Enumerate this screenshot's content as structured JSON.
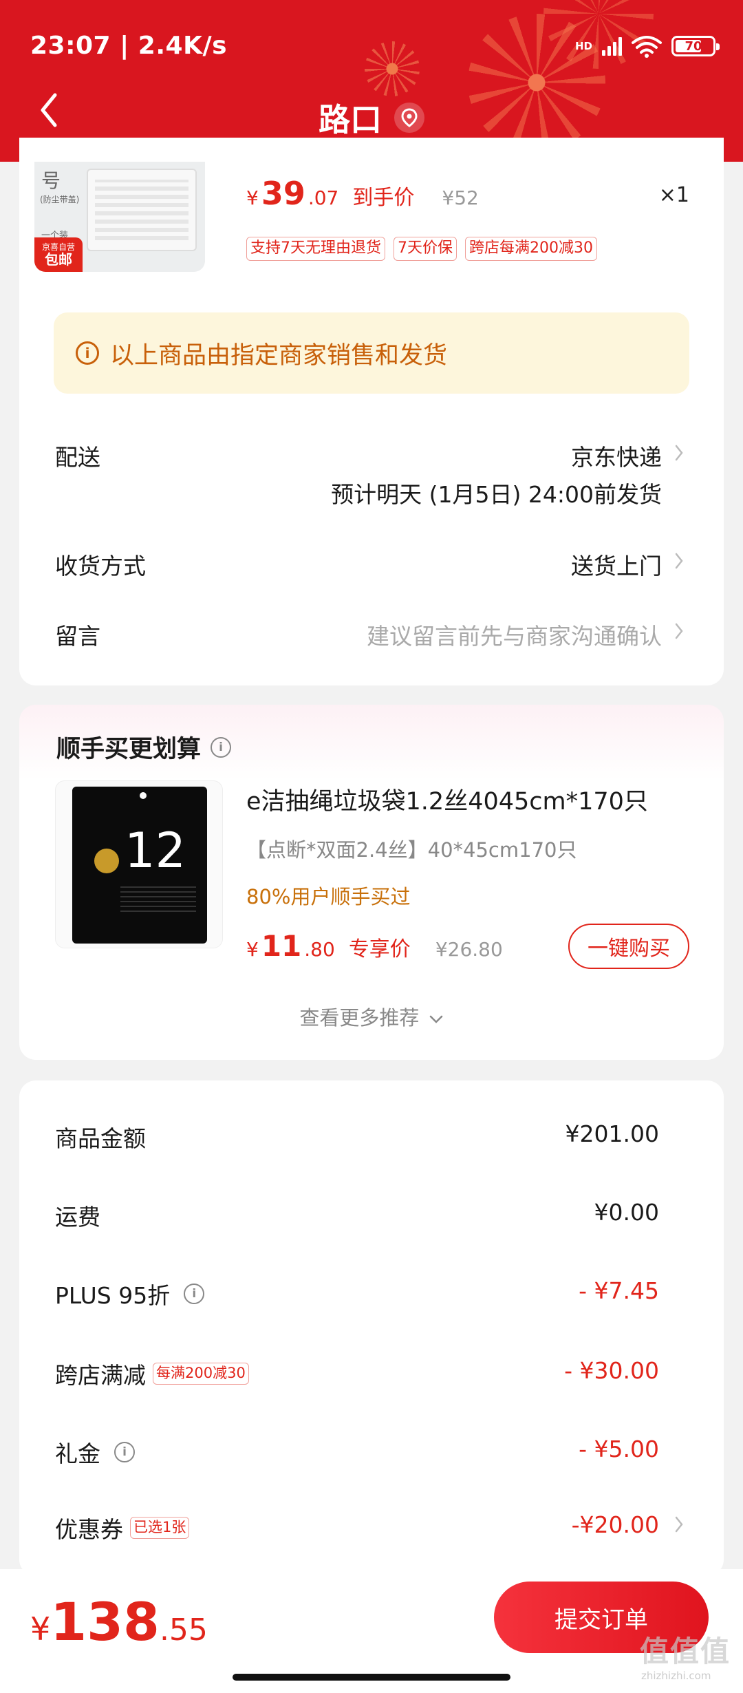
{
  "status_bar": {
    "time": "23:07 | 2.4K/s",
    "network": "HD",
    "battery": "70"
  },
  "header": {
    "title": "路口",
    "icons": {
      "back": "chevron-left-icon",
      "location": "location-pin-icon"
    }
  },
  "product": {
    "thumb_note1": "号",
    "thumb_note2": "(防尘带盖)",
    "thumb_note3": "一个装",
    "badge_line1": "京喜自营",
    "badge_line2": "包邮",
    "currency": "¥",
    "price_int": "39",
    "price_dec": ".07",
    "price_label": "到手价",
    "orig_price": "¥52",
    "qty": "×1",
    "tags": [
      "支持7天无理由退货",
      "7天价保",
      "跨店每满200减30"
    ]
  },
  "notice": {
    "text": "以上商品由指定商家销售和发货"
  },
  "delivery": {
    "label": "配送",
    "carrier": "京东快递",
    "eta": "预计明天 (1月5日) 24:00前发货"
  },
  "receive": {
    "label": "收货方式",
    "value": "送货上门"
  },
  "message": {
    "label": "留言",
    "placeholder": "建议留言前先与商家沟通确认"
  },
  "recommend": {
    "title": "顺手买更划算",
    "name": "e洁抽绳垃圾袋1.2丝4045cm*170只",
    "spec": "【点断*双面2.4丝】40*45cm170只",
    "popularity": "80%用户顺手买过",
    "currency": "¥",
    "price_int": "11",
    "price_dec": ".80",
    "price_label": "专享价",
    "orig_price": "¥26.80",
    "buy_label": "一键购买",
    "more_label": "查看更多推荐",
    "bag_number": "12"
  },
  "summary": {
    "goods_label": "商品金额",
    "goods_value": "¥201.00",
    "freight_label": "运费",
    "freight_value": "¥0.00",
    "plus_label": "PLUS 95折",
    "plus_value": "- ¥7.45",
    "cross_label": "跨店满减",
    "cross_tag": "每满200减30",
    "cross_value": "- ¥30.00",
    "gift_label": "礼金",
    "gift_value": "- ¥5.00",
    "coupon_label": "优惠券",
    "coupon_tag": "已选1张",
    "coupon_value": "-¥20.00"
  },
  "checkout": {
    "currency": "¥",
    "total_int": "138",
    "total_dec": ".55",
    "submit_label": "提交订单"
  },
  "watermark": {
    "text": "值值值",
    "site": "zhizhizhi.com"
  },
  "colors": {
    "brand_red": "#d9161f",
    "price_red": "#e1251b",
    "notice_bg": "#fdf6dc",
    "notice_text": "#c8600a"
  }
}
